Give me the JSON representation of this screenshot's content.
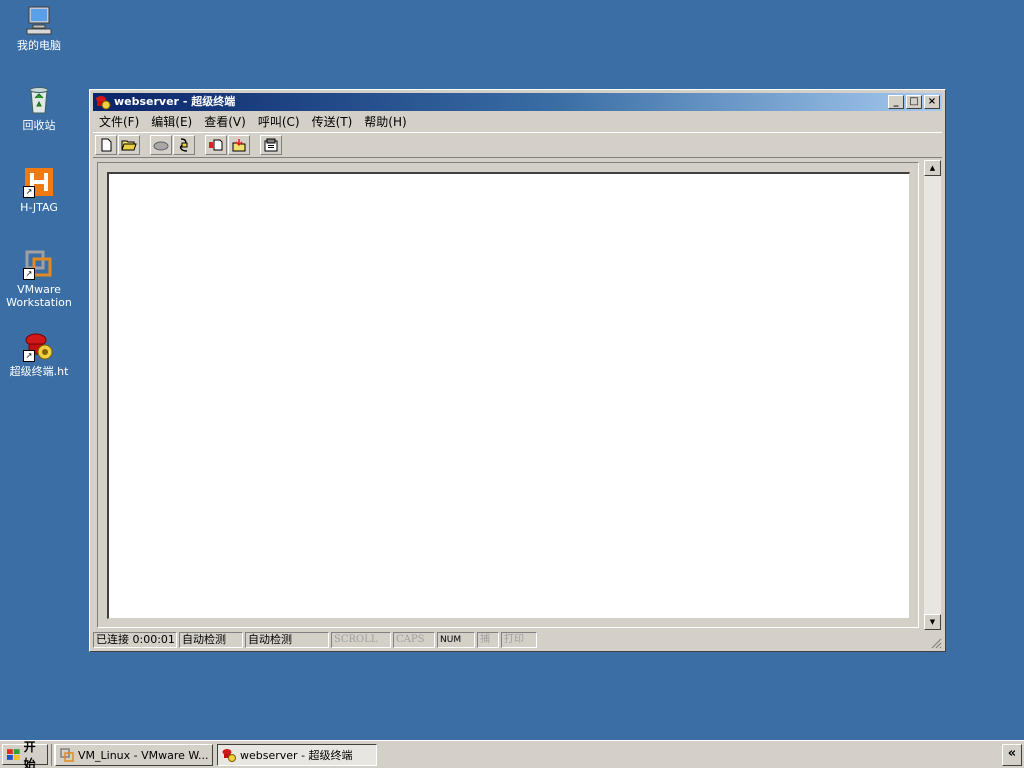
{
  "desktop": {
    "icons": [
      {
        "label": "我的电脑",
        "icon": "my-computer-icon"
      },
      {
        "label": "回收站",
        "icon": "recycle-bin-icon"
      },
      {
        "label": "H-JTAG",
        "icon": "h-jtag-icon"
      },
      {
        "label": "VMware\nWorkstation",
        "icon": "vmware-icon"
      },
      {
        "label": "超级终端.ht",
        "icon": "hyperterminal-icon"
      }
    ]
  },
  "window": {
    "title": "webserver - 超级终端",
    "buttons": {
      "minimize": "_",
      "maximize": "□",
      "close": "×"
    },
    "menu": [
      {
        "label": "文件(F)"
      },
      {
        "label": "编辑(E)"
      },
      {
        "label": "查看(V)"
      },
      {
        "label": "呼叫(C)"
      },
      {
        "label": "传送(T)"
      },
      {
        "label": "帮助(H)"
      }
    ],
    "toolbar": [
      {
        "icon": "new-icon"
      },
      {
        "icon": "open-icon"
      },
      {
        "icon": "call-icon"
      },
      {
        "icon": "disconnect-icon"
      },
      {
        "icon": "send-icon"
      },
      {
        "icon": "receive-icon"
      },
      {
        "icon": "properties-icon"
      }
    ],
    "statusbar": {
      "connection": "已连接 0:00:01",
      "detect1": "自动检测",
      "detect2": "自动检测",
      "scroll": "SCROLL",
      "caps": "CAPS",
      "num": "NUM",
      "capture": "捕",
      "print": "打印"
    }
  },
  "taskbar": {
    "start_label": "开始",
    "tasks": [
      {
        "label": "VM_Linux - VMware W...",
        "active": false
      },
      {
        "label": "webserver - 超级终端",
        "active": true
      }
    ],
    "tray_toggle": "«"
  },
  "colors": {
    "desktop": "#3a6ea5",
    "title_start": "#0a246a",
    "title_end": "#a6caf0",
    "chrome": "#d4d0c8"
  }
}
